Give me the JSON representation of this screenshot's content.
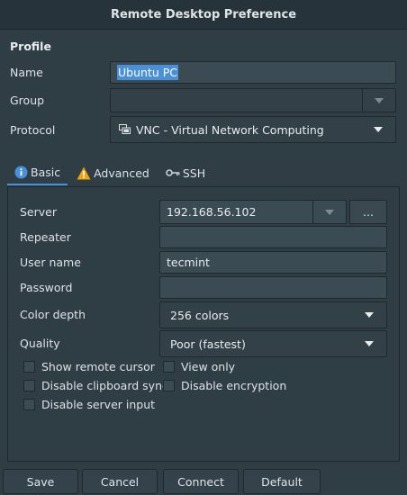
{
  "window": {
    "title": "Remote Desktop Preference"
  },
  "profile": {
    "section_title": "Profile",
    "name_label": "Name",
    "name_value": "Ubuntu PC",
    "group_label": "Group",
    "group_value": "",
    "protocol_label": "Protocol",
    "protocol_value": "VNC - Virtual Network Computing"
  },
  "tabs": [
    {
      "label": "Basic",
      "icon": "info-icon"
    },
    {
      "label": "Advanced",
      "icon": "warning-icon"
    },
    {
      "label": "SSH",
      "icon": "key-icon"
    }
  ],
  "basic": {
    "server_label": "Server",
    "server_value": "192.168.56.102",
    "server_browse_label": "...",
    "repeater_label": "Repeater",
    "repeater_value": "",
    "username_label": "User name",
    "username_value": "tecmint",
    "password_label": "Password",
    "password_value": "",
    "color_depth_label": "Color depth",
    "color_depth_value": "256 colors",
    "quality_label": "Quality",
    "quality_value": "Poor (fastest)",
    "checks": {
      "show_remote_cursor": "Show remote cursor",
      "view_only": "View only",
      "disable_clipboard_sync": "Disable clipboard sync",
      "disable_encryption": "Disable encryption",
      "disable_server_input": "Disable server input"
    }
  },
  "buttons": {
    "save": "Save",
    "cancel": "Cancel",
    "connect": "Connect",
    "default": "Default"
  },
  "colors": {
    "accent": "#4a90d9",
    "background": "#2f3d45",
    "warning": "#f0a30a"
  }
}
